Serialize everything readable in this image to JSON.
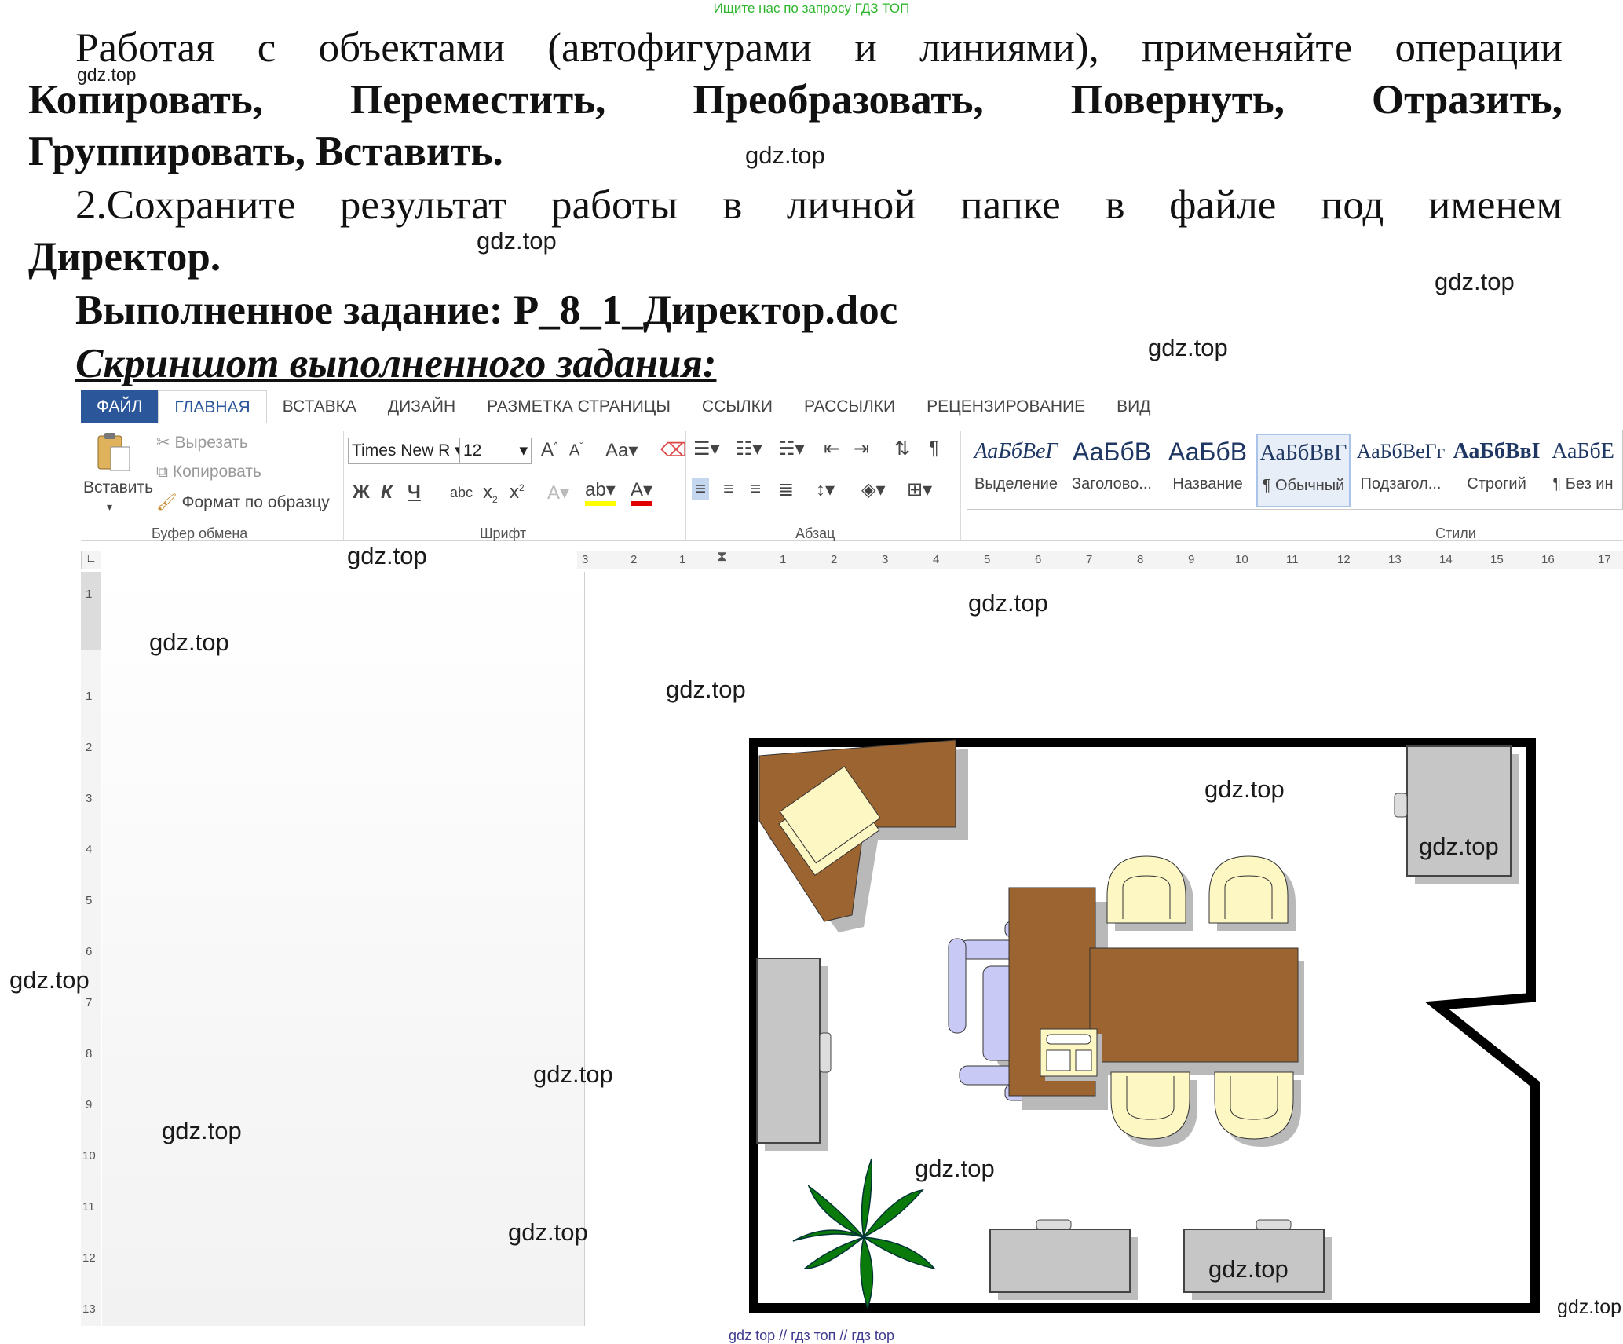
{
  "header": {
    "search_hint": "Ищите нас по запросу ГДЗ ТОП"
  },
  "task": {
    "line1_words": [
      "Работая",
      "с",
      "объектами",
      "(автофигурами",
      "и",
      "линиями),",
      "применяйте",
      "операции"
    ],
    "line2_words": [
      "Копировать,",
      "Переместить,",
      "Преобразовать,",
      "Повернуть,",
      "Отразить,"
    ],
    "line3": "Группировать, Вставить.",
    "line4_words": [
      "2.Сохраните",
      "результат",
      "работы",
      "в",
      "личной",
      "папке",
      "в",
      "файле",
      "под",
      "именем"
    ],
    "line5": "Директор.",
    "line6": "Выполненное задание: P_8_1_Директор.doc",
    "line7": "Скриншот выполненного задания:"
  },
  "ribbon": {
    "tabs": [
      "ФАЙЛ",
      "ГЛАВНАЯ",
      "ВСТАВКА",
      "ДИЗАЙН",
      "РАЗМЕТКА СТРАНИЦЫ",
      "ССЫЛКИ",
      "РАССЫЛКИ",
      "РЕЦЕНЗИРОВАНИЕ",
      "ВИД"
    ],
    "clipboard": {
      "paste": "Вставить",
      "cut": "Вырезать",
      "copy": "Копировать",
      "format_painter": "Формат по образцу",
      "label": "Буфер обмена"
    },
    "font": {
      "name": "Times New R",
      "size": "12",
      "bold": "Ж",
      "italic": "К",
      "underline": "Ч",
      "strike": "abc",
      "label": "Шрифт"
    },
    "paragraph": {
      "label": "Абзац"
    },
    "styles": {
      "label": "Стили",
      "items": [
        {
          "sample": "АаБбВеГ",
          "name": "Выделение"
        },
        {
          "sample": "АаБбВ",
          "name": "Заголово..."
        },
        {
          "sample": "АаБбВ",
          "name": "Название"
        },
        {
          "sample": "АаБбВвГ",
          "name": "¶ Обычный"
        },
        {
          "sample": "АаБбВеГг",
          "name": "Подзагол..."
        },
        {
          "sample": "АаБбВвI",
          "name": "Строгий"
        },
        {
          "sample": "АаБбЕ",
          "name": "¶ Без ин"
        }
      ]
    }
  },
  "ruler": {
    "h_left": [
      "3",
      "2",
      "1"
    ],
    "h_right": [
      "1",
      "2",
      "3",
      "4",
      "5",
      "6",
      "7",
      "8",
      "9",
      "10",
      "11",
      "12",
      "13",
      "14",
      "15",
      "16",
      "17"
    ],
    "v": [
      "1",
      "1",
      "2",
      "3",
      "4",
      "5",
      "6",
      "7",
      "8",
      "9",
      "10",
      "11",
      "12",
      "13"
    ]
  },
  "watermark": "gdz.top",
  "footer": "gdz top // гдз топ // гдз top"
}
